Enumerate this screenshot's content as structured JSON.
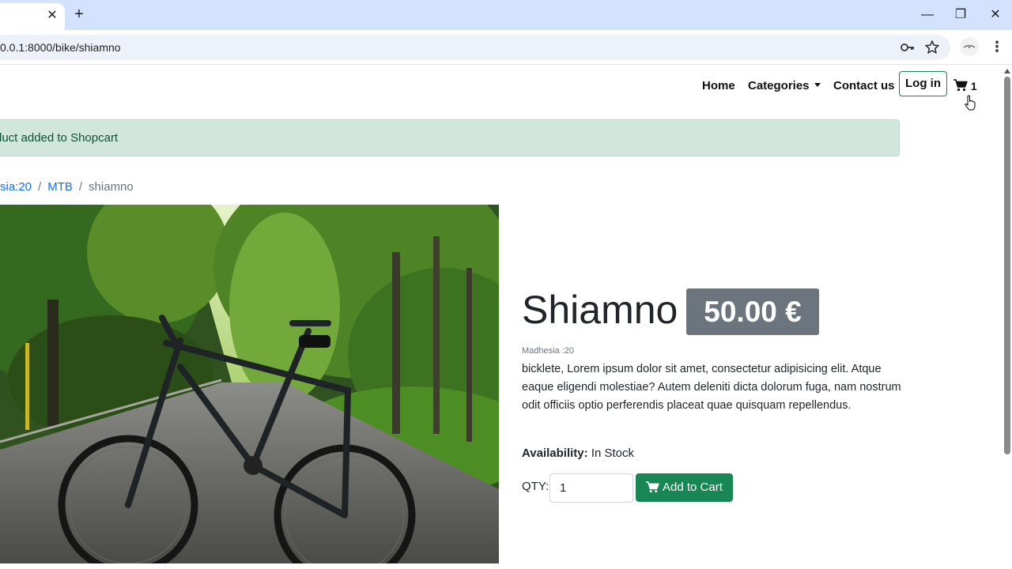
{
  "browser": {
    "tab_close": "✕",
    "new_tab": "+",
    "url": "0.0.1:8000/bike/shiamno",
    "window": {
      "minimize": "—",
      "restore": "❐",
      "close": "✕"
    }
  },
  "nav": {
    "home": "Home",
    "categories": "Categories",
    "contact": "Contact us",
    "login": "Log in",
    "cart_count": "1"
  },
  "alert": {
    "message": "luct added to Shopcart"
  },
  "breadcrumb": {
    "items": [
      "sia:20",
      "MTB"
    ],
    "separator": "/",
    "current": "shiamno"
  },
  "product": {
    "title": "Shiamno",
    "price": "50.00 €",
    "category": "Madhesia :20",
    "description": "bicklete, Lorem ipsum dolor sit amet, consectetur adipisicing elit. Atque eaque eligendi molestiae? Autem deleniti dicta dolorum fuga, nam nostrum odit officiis optio perferendis placeat quae quisquam repellendus.",
    "availability_label": "Availability:",
    "availability_value": "In Stock",
    "qty_label": "QTY:",
    "qty_value": "1",
    "add_to_cart": "Add to Cart"
  },
  "colors": {
    "success": "#198754",
    "alert_bg": "#d1e7dd",
    "price_badge": "#6c757d",
    "link": "#0d6efd",
    "tabstrip": "#d3e3fd"
  }
}
